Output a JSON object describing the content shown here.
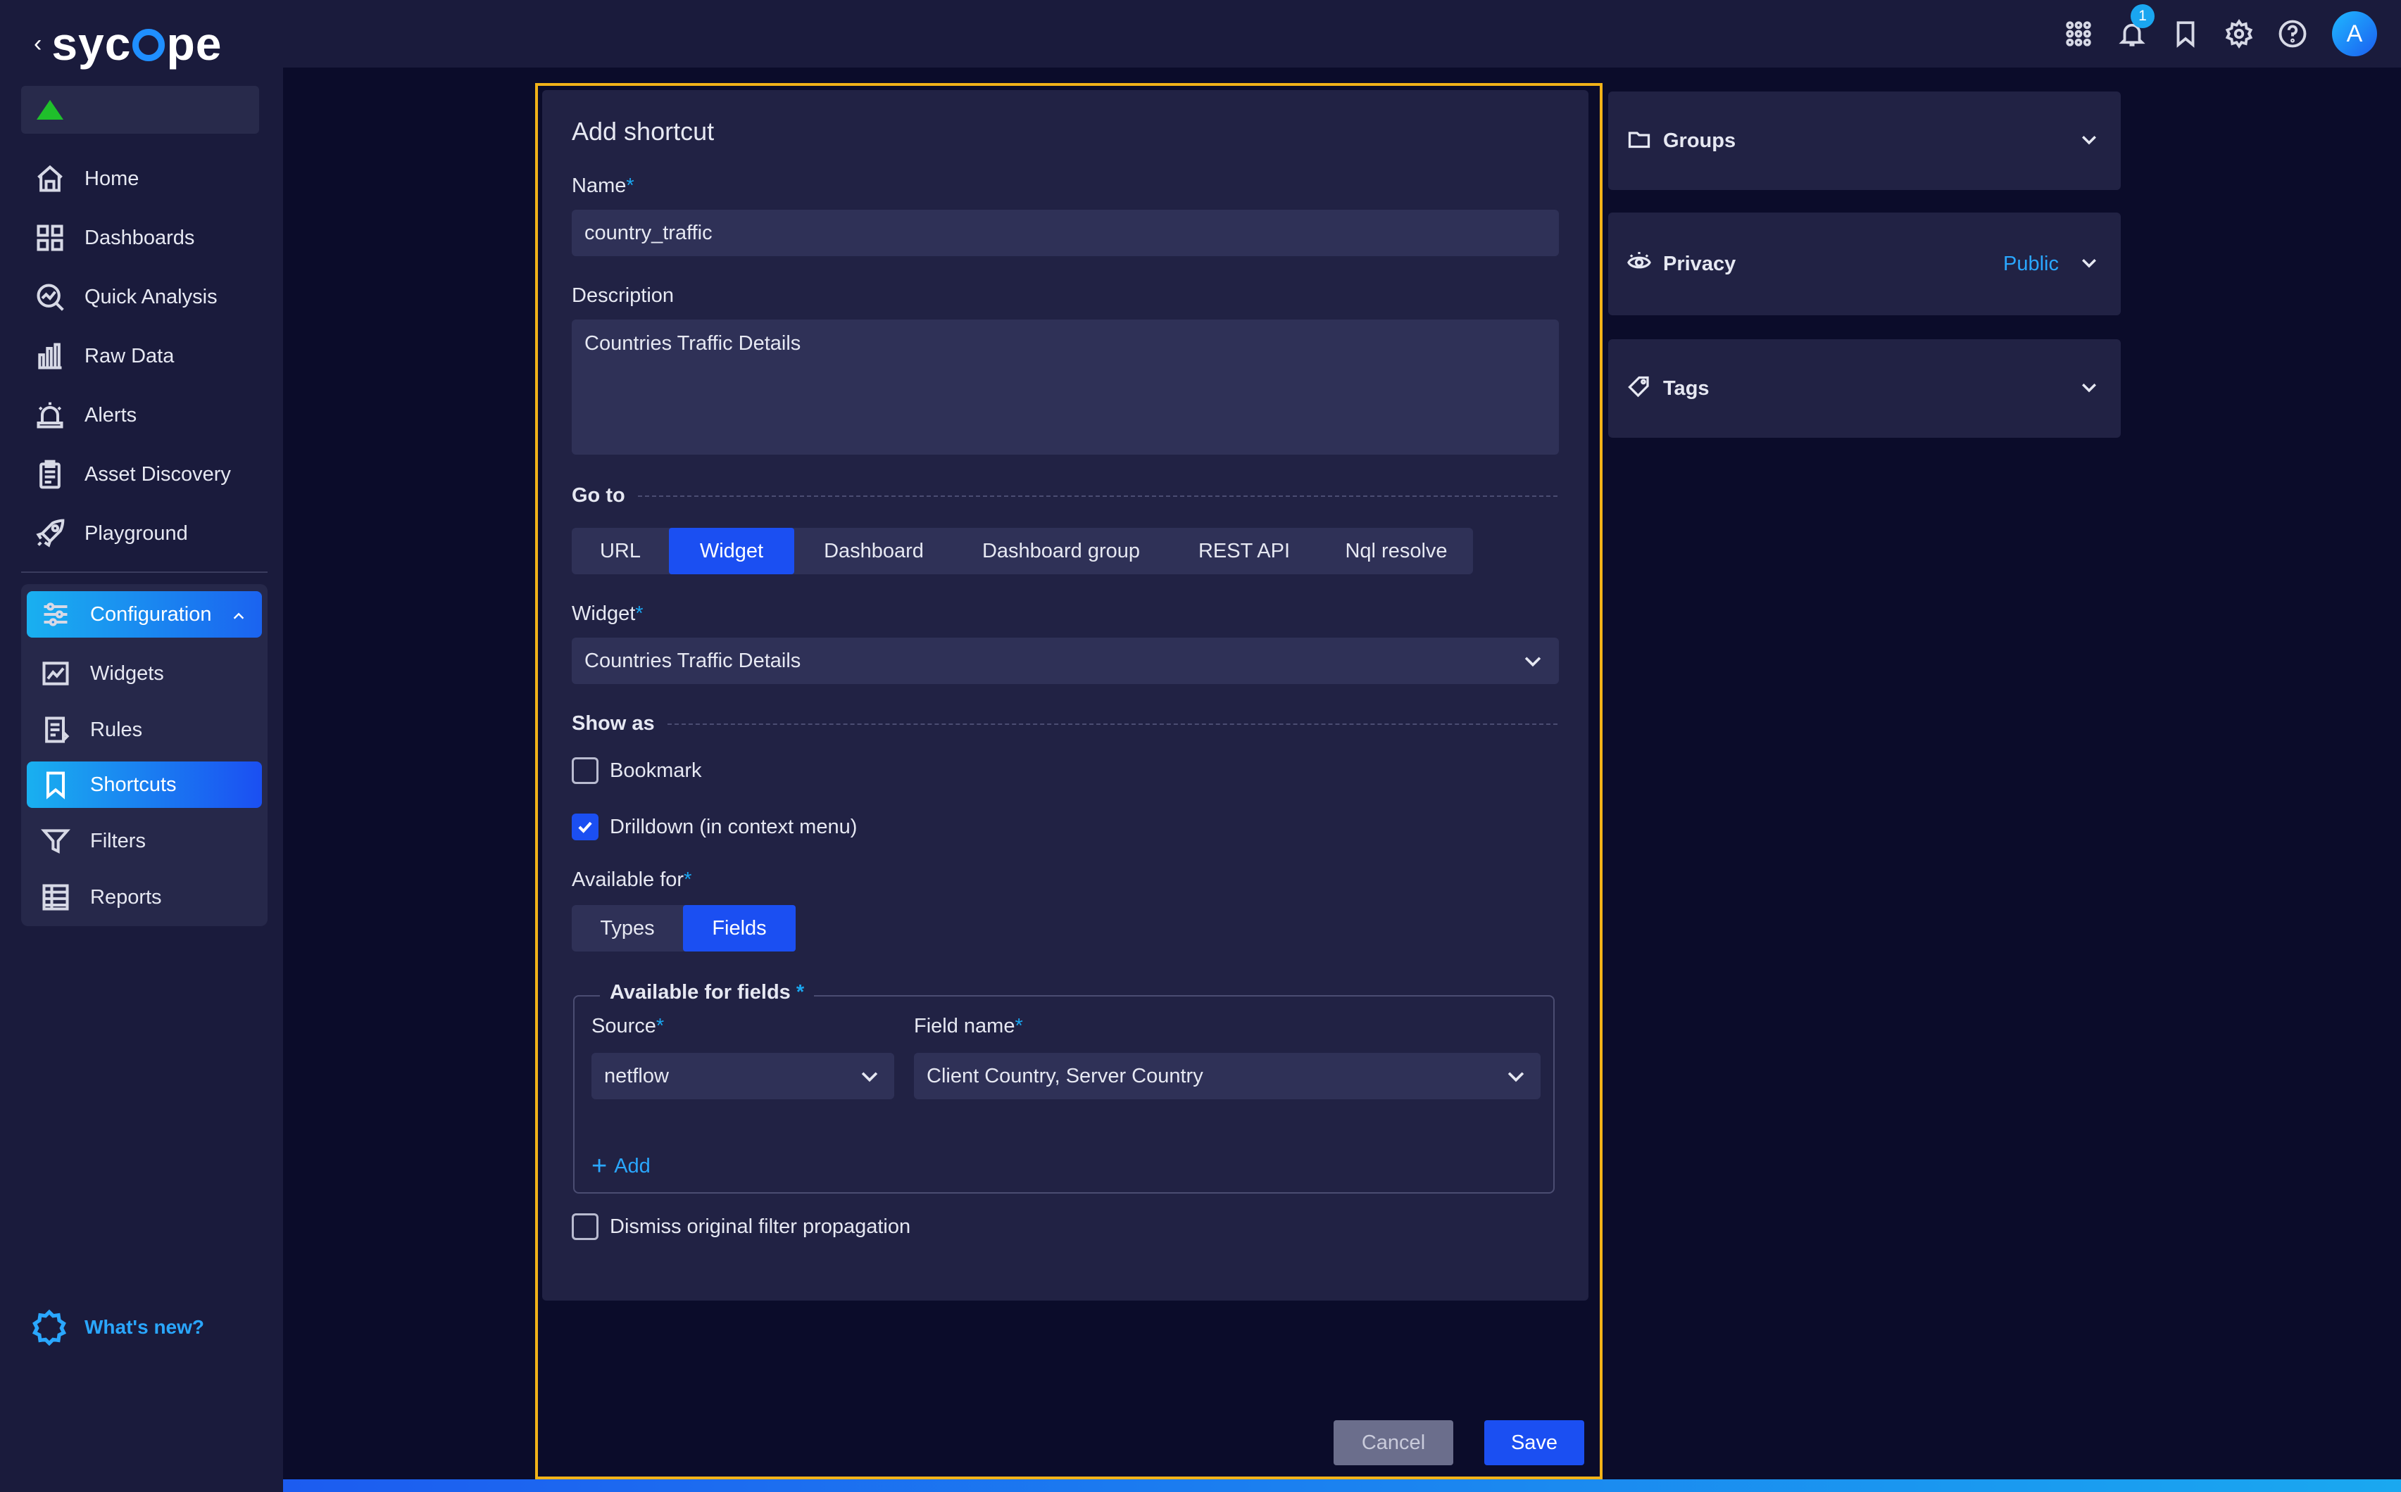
{
  "brand": {
    "logo_text_pre": "syc",
    "logo_text_post": "pe",
    "back_glyph": "‹",
    "status_color": "#1fbf2b",
    "accent": "#1b4ff2",
    "frame_color": "#f2b319"
  },
  "sidebar": {
    "items": [
      {
        "label": "Home",
        "icon": "home-icon"
      },
      {
        "label": "Dashboards",
        "icon": "dashboards-icon"
      },
      {
        "label": "Quick Analysis",
        "icon": "quick-analysis-icon"
      },
      {
        "label": "Raw Data",
        "icon": "raw-data-icon"
      },
      {
        "label": "Alerts",
        "icon": "alerts-icon"
      },
      {
        "label": "Asset Discovery",
        "icon": "asset-discovery-icon"
      },
      {
        "label": "Playground",
        "icon": "playground-icon"
      }
    ],
    "configuration": {
      "label": "Configuration",
      "sub_items": [
        {
          "label": "Widgets",
          "icon": "widgets-icon"
        },
        {
          "label": "Rules",
          "icon": "rules-icon"
        },
        {
          "label": "Shortcuts",
          "icon": "shortcuts-icon",
          "active": true
        },
        {
          "label": "Filters",
          "icon": "filters-icon"
        },
        {
          "label": "Reports",
          "icon": "reports-icon"
        }
      ]
    },
    "whats_new": "What's new?"
  },
  "topbar": {
    "notification_count": "1",
    "avatar_letter": "A"
  },
  "form": {
    "title": "Add shortcut",
    "name_label": "Name",
    "name_value": "country_traffic",
    "description_label": "Description",
    "description_value": "Countries Traffic Details",
    "goto_label": "Go to",
    "goto_options": [
      "URL",
      "Widget",
      "Dashboard",
      "Dashboard group",
      "REST API",
      "Nql resolve"
    ],
    "goto_selected": "Widget",
    "widget_label": "Widget",
    "widget_value": "Countries Traffic Details",
    "show_as_label": "Show as",
    "bookmark_label": "Bookmark",
    "bookmark_checked": false,
    "drilldown_label": "Drilldown (in context menu)",
    "drilldown_checked": true,
    "available_for_label": "Available for",
    "available_for_options": [
      "Types",
      "Fields"
    ],
    "available_for_selected": "Fields",
    "fields_legend": "Available for fields",
    "source_label": "Source",
    "source_value": "netflow",
    "field_name_label": "Field name",
    "field_name_value": "Client Country, Server Country",
    "add_label": "Add",
    "dismiss_label": "Dismiss original filter propagation",
    "dismiss_checked": false,
    "required_mark": "*"
  },
  "buttons": {
    "cancel": "Cancel",
    "save": "Save"
  },
  "right_panels": {
    "groups": "Groups",
    "privacy": "Privacy",
    "privacy_value": "Public",
    "tags": "Tags"
  }
}
